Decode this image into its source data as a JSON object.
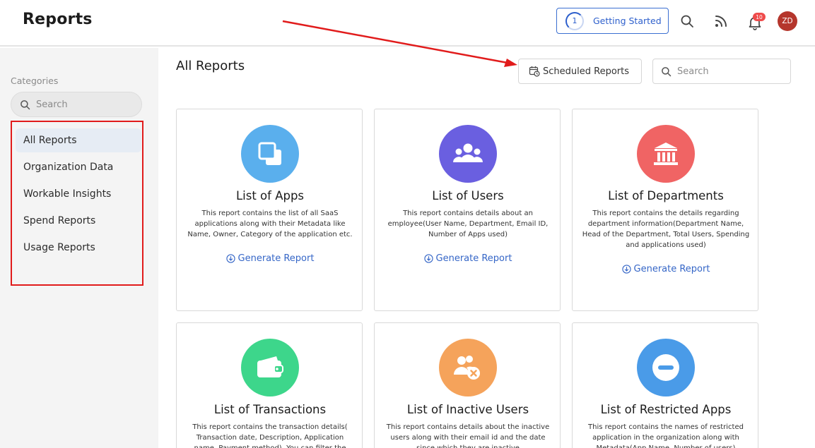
{
  "header": {
    "title": "Reports",
    "getting_started": {
      "step": "1",
      "label": "Getting Started"
    },
    "notification_count": "10",
    "avatar_initials": "ZD"
  },
  "sidebar": {
    "categories_label": "Categories",
    "search_placeholder": "Search",
    "items": [
      {
        "label": "All Reports",
        "active": true
      },
      {
        "label": "Organization Data"
      },
      {
        "label": "Workable Insights"
      },
      {
        "label": "Spend Reports"
      },
      {
        "label": "Usage Reports"
      }
    ]
  },
  "main": {
    "title": "All Reports",
    "scheduled_reports_label": "Scheduled Reports",
    "search_placeholder": "Search",
    "generate_label": "Generate Report",
    "cards": [
      {
        "title": "List of Apps",
        "desc": "This report contains the list of all SaaS applications along with their Metadata like Name, Owner, Category of the application etc.",
        "icon": "apps-icon",
        "color": "#5aafed"
      },
      {
        "title": "List of Users",
        "desc": "This report contains details about an employee(User Name, Department, Email ID, Number of Apps used)",
        "icon": "users-icon",
        "color": "#6a5fe0"
      },
      {
        "title": "List of Departments",
        "desc": "This report contains the details regarding department information(Department Name, Head of the Department, Total Users, Spending and applications used)",
        "icon": "department-icon",
        "color": "#f06464"
      },
      {
        "title": "List of Transactions",
        "desc": "This report contains the transaction details( Transaction date, Description, Application name, Payment method). You can filter the",
        "icon": "wallet-icon",
        "color": "#3dd68b"
      },
      {
        "title": "List of Inactive Users",
        "desc": "This report contains details about the inactive users along with their email id and the date since which they are inactive",
        "icon": "inactive-users-icon",
        "color": "#f5a35b"
      },
      {
        "title": "List of Restricted Apps",
        "desc": "This report contains the names of restricted application in the organization along with Metadata(App Name, Number of users)",
        "icon": "restricted-icon",
        "color": "#4a9be8"
      }
    ]
  },
  "colors": {
    "accent": "#3566c7",
    "annotation": "#e11b1b"
  }
}
